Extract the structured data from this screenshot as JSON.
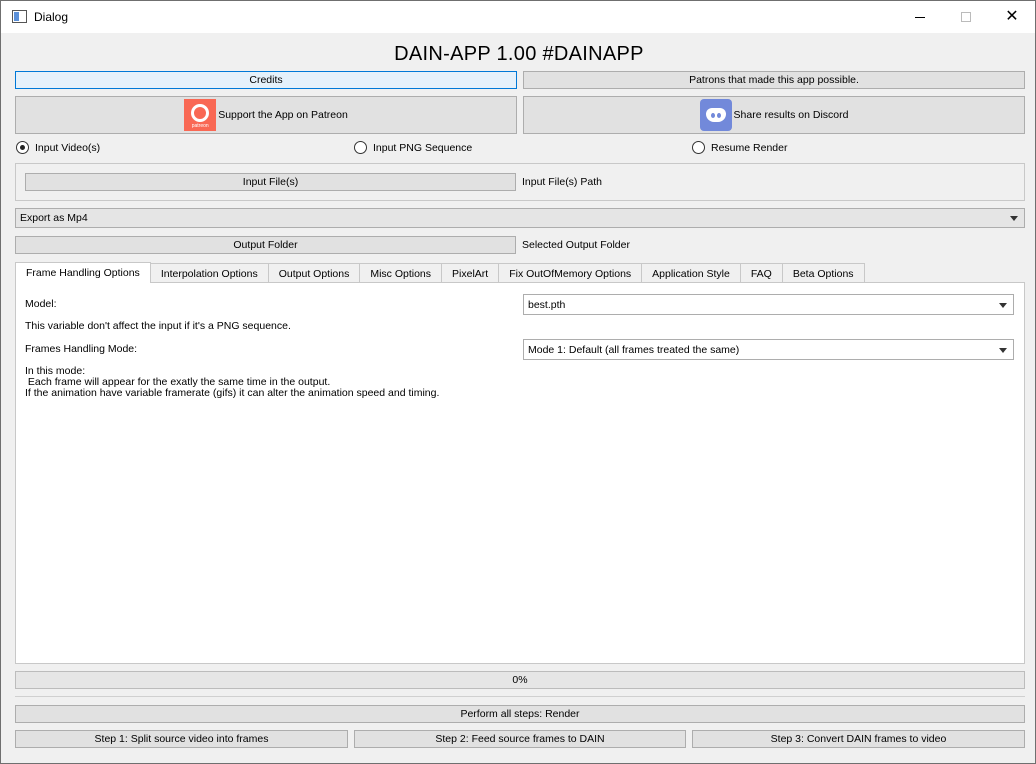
{
  "window": {
    "title": "Dialog",
    "controls": {
      "minimize": "minimize",
      "maximize": "maximize",
      "close": "✕"
    }
  },
  "header": {
    "title": "DAIN-APP 1.00 #DAINAPP"
  },
  "top_buttons": {
    "credits": "Credits",
    "patrons": "Patrons that made this app possible.",
    "patreon": "Support the App on Patreon",
    "patreon_logo_text": "patreon",
    "discord": "Share results on Discord"
  },
  "input_mode": {
    "options": [
      {
        "label": "Input Video(s)",
        "checked": true
      },
      {
        "label": "Input PNG Sequence",
        "checked": false
      },
      {
        "label": "Resume Render",
        "checked": false
      }
    ]
  },
  "input": {
    "button": "Input File(s)",
    "path_label": "Input File(s) Path"
  },
  "export": {
    "selected": "Export as Mp4"
  },
  "output": {
    "button": "Output Folder",
    "path_label": "Selected Output Folder"
  },
  "tabs": [
    {
      "label": "Frame Handling Options",
      "active": true
    },
    {
      "label": "Interpolation Options",
      "active": false
    },
    {
      "label": "Output Options",
      "active": false
    },
    {
      "label": "Misc Options",
      "active": false
    },
    {
      "label": "PixelArt",
      "active": false
    },
    {
      "label": "Fix OutOfMemory Options",
      "active": false
    },
    {
      "label": "Application Style",
      "active": false
    },
    {
      "label": "FAQ",
      "active": false
    },
    {
      "label": "Beta Options",
      "active": false
    }
  ],
  "frame_handling": {
    "model_label": "Model:",
    "model_value": "best.pth",
    "model_note": "This variable don't affect the input if it's a PNG sequence.",
    "mode_label": "Frames Handling Mode:",
    "mode_value": "Mode 1: Default (all frames treated the same)",
    "mode_description": "In this mode:\n Each frame will appear for the exatly the same time in the output.\nIf the animation have variable framerate (gifs) it can alter the animation speed and timing."
  },
  "progress": {
    "value": 0,
    "text": "0%"
  },
  "actions": {
    "render_all": "Perform all steps: Render",
    "step1": "Step 1: Split source video into frames",
    "step2": "Step 2: Feed source frames to DAIN",
    "step3": "Step 3: Convert DAIN frames to video"
  }
}
